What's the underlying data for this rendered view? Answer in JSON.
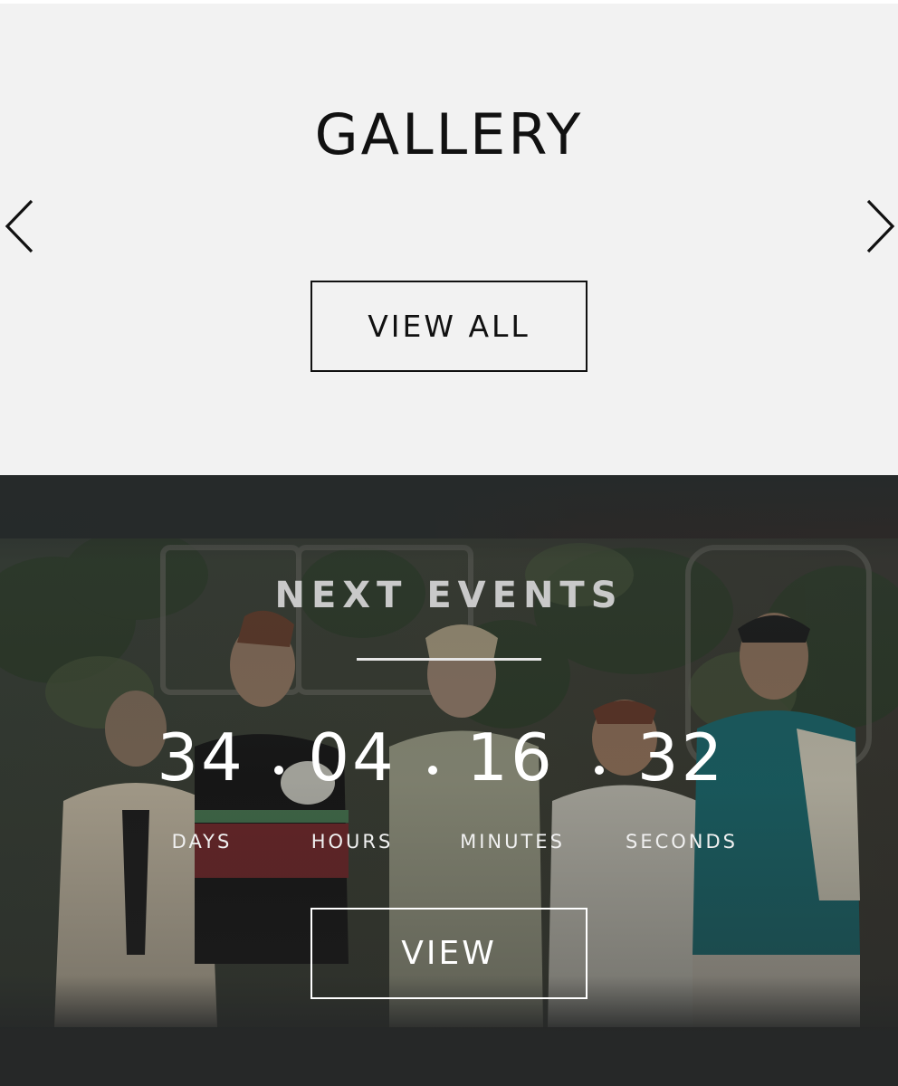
{
  "gallery": {
    "title": "GALLERY",
    "prev_icon": "chevron-left-icon",
    "next_icon": "chevron-right-icon",
    "view_all_label": "VIEW ALL"
  },
  "events": {
    "title": "NEXT EVENTS",
    "countdown": {
      "days": {
        "value": "34",
        "label": "DAYS"
      },
      "hours": {
        "value": "04",
        "label": "HOURS"
      },
      "minutes": {
        "value": "16",
        "label": "MINUTES"
      },
      "seconds": {
        "value": "32",
        "label": "SECONDS"
      }
    },
    "view_label": "VIEW"
  },
  "colors": {
    "gallery_bg": "#f2f2f2",
    "events_bg": "#262a2a",
    "text_dark": "#111111",
    "text_light": "#ffffff"
  }
}
